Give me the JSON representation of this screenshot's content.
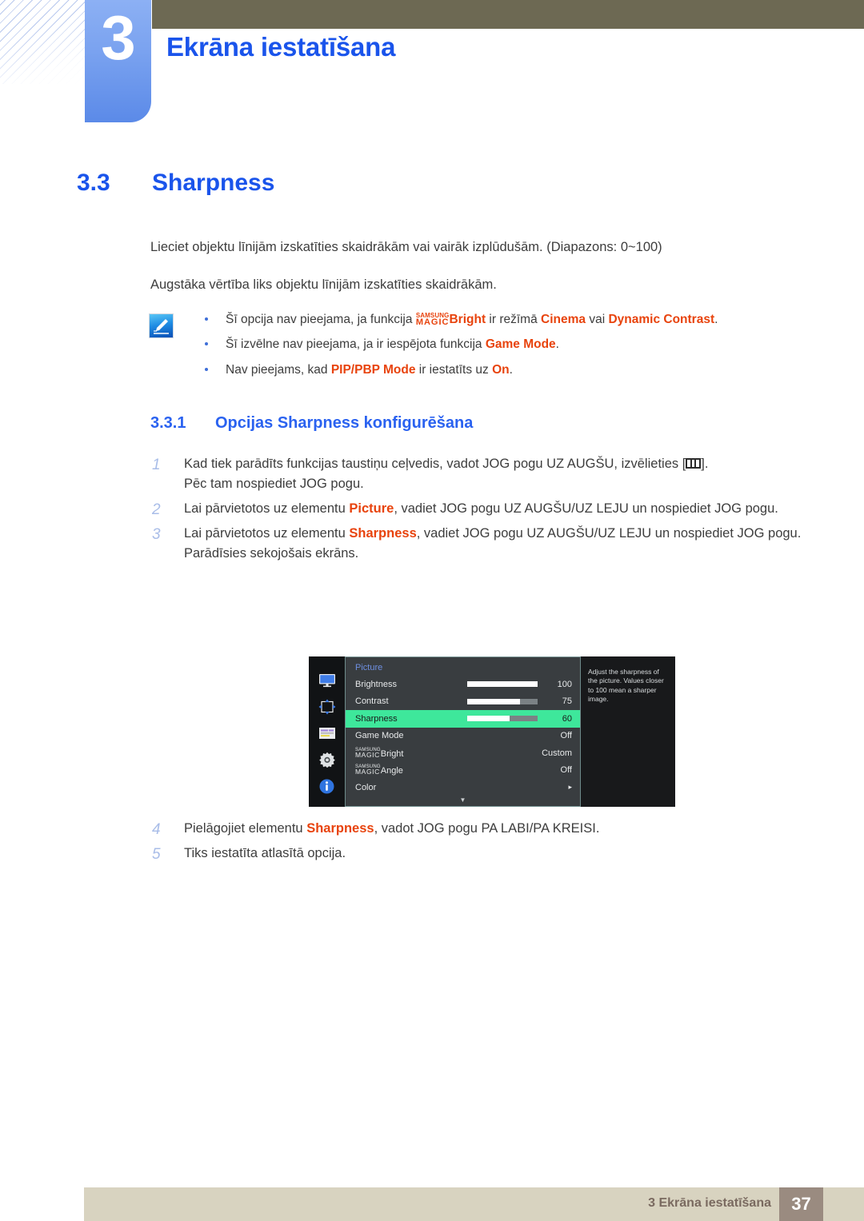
{
  "header": {
    "chapter_number": "3",
    "chapter_title": "Ekrāna iestatīšana",
    "band_color": "#6d6953",
    "tab_color": "#7ba3f0",
    "title_color": "#1a54eb"
  },
  "section": {
    "number": "3.3",
    "title": "Sharpness"
  },
  "intro": {
    "paragraph_1": "Lieciet objektu līnijām izskatīties skaidrākām vai vairāk izplūdušām. (Diapazons: 0~100)",
    "paragraph_2": "Augstāka vērtība liks objektu līnijām izskatīties skaidrākām."
  },
  "note": {
    "icon": "note-pen-icon",
    "bullets": [
      {
        "parts": [
          {
            "text": "Šī opcija nav pieejama, ja funkcija ",
            "style": "normal"
          },
          {
            "text": "SAMSUNG MAGIC",
            "style": "magic"
          },
          {
            "text": "Bright",
            "style": "highlight"
          },
          {
            "text": " ir režīmā ",
            "style": "normal"
          },
          {
            "text": "Cinema",
            "style": "highlight"
          },
          {
            "text": " vai ",
            "style": "normal"
          },
          {
            "text": "Dynamic Contrast",
            "style": "highlight"
          },
          {
            "text": ".",
            "style": "normal"
          }
        ]
      },
      {
        "parts": [
          {
            "text": "Šī izvēlne nav pieejama, ja ir iespējota funkcija ",
            "style": "normal"
          },
          {
            "text": "Game Mode",
            "style": "highlight"
          },
          {
            "text": ".",
            "style": "normal"
          }
        ]
      },
      {
        "parts": [
          {
            "text": "Nav pieejams, kad ",
            "style": "normal"
          },
          {
            "text": "PIP/PBP Mode",
            "style": "highlight"
          },
          {
            "text": " ir iestatīts uz ",
            "style": "normal"
          },
          {
            "text": "On",
            "style": "highlight"
          },
          {
            "text": ".",
            "style": "normal"
          }
        ]
      }
    ],
    "highlight_color": "#e8430d"
  },
  "subsection": {
    "number": "3.3.1",
    "title": "Opcijas Sharpness konfigurēšana"
  },
  "steps_before": [
    {
      "number": "1",
      "line_1_pre": "Kad tiek parādīts funkcijas taustiņu ceļvedis, vadot JOG pogu UZ AUGŠU, izvēlieties [",
      "line_1_post": "].",
      "line_2": "Pēc tam nospiediet JOG pogu."
    },
    {
      "number": "2",
      "line_1_pre": "Lai pārvietotos uz elementu ",
      "line_1_hl": "Picture",
      "line_1_post": ", vadiet JOG pogu UZ AUGŠU/UZ LEJU un nospiediet JOG pogu."
    },
    {
      "number": "3",
      "line_1_pre": "Lai pārvietotos uz elementu ",
      "line_1_hl": "Sharpness",
      "line_1_post": ", vadiet JOG pogu UZ AUGŠU/UZ LEJU un nospiediet JOG pogu.",
      "line_2": "Parādīsies sekojošais ekrāns."
    }
  ],
  "steps_after": [
    {
      "number": "4",
      "line_1_pre": "Pielāgojiet elementu ",
      "line_1_hl": "Sharpness",
      "line_1_post": ", vadot JOG pogu PA LABI/PA KREISI."
    },
    {
      "number": "5",
      "line_1_pre": "Tiks iestatīta atlasītā opcija.",
      "line_1_hl": "",
      "line_1_post": ""
    }
  ],
  "osd": {
    "menu_title": "Picture",
    "rail_icons": [
      "monitor-icon",
      "pip-arrows-icon",
      "onscreen-display-icon",
      "gear-icon",
      "info-icon"
    ],
    "rows": [
      {
        "label": "Brightness",
        "type": "slider",
        "fill_percent": 100,
        "value": "100",
        "selected": false
      },
      {
        "label": "Contrast",
        "type": "slider",
        "fill_percent": 75,
        "value": "75",
        "selected": false
      },
      {
        "label": "Sharpness",
        "type": "slider",
        "fill_percent": 60,
        "value": "60",
        "selected": true
      },
      {
        "label": "Game Mode",
        "type": "value",
        "value": "Off",
        "selected": false
      },
      {
        "label": "MAGICBright",
        "type": "magic",
        "magic_suffix": "Bright",
        "value": "Custom",
        "selected": false
      },
      {
        "label": "MAGICAngle",
        "type": "magic",
        "magic_suffix": "Angle",
        "value": "Off",
        "selected": false
      },
      {
        "label": "Color",
        "type": "submenu",
        "value": "▸",
        "selected": false
      }
    ],
    "scroll_glyph": "▼",
    "tooltip": "Adjust the sharpness of the picture. Values closer to 100 mean a sharper image.",
    "highlight_color": "#3ee79b",
    "background_color": "#393d40"
  },
  "footer": {
    "text": "3 Ekrāna iestatīšana",
    "page": "37",
    "bar_color": "#d8d3c0",
    "page_box_color": "#9a8b80"
  }
}
